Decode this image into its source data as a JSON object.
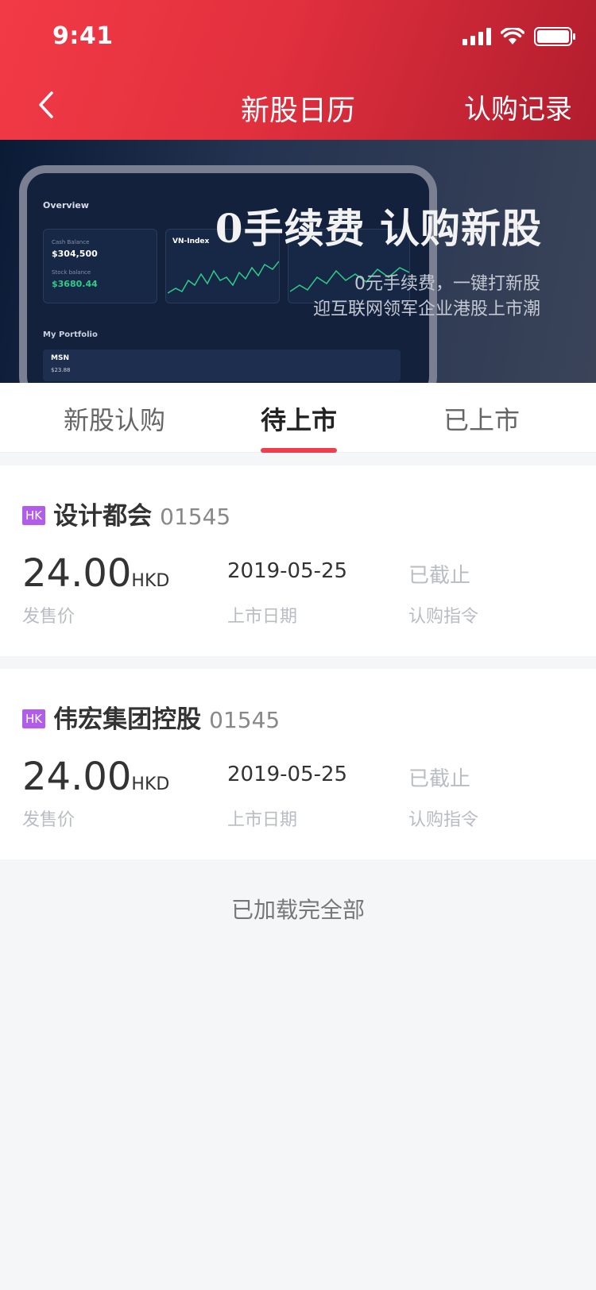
{
  "status_bar": {
    "time": "9:41"
  },
  "header": {
    "title": "新股日历",
    "right_link": "认购记录"
  },
  "banner": {
    "title": "0手续费 认购新股",
    "subtitle_line1": "0元手续费，一键打新股",
    "subtitle_line2": "迎互联网领军企业港股上市潮"
  },
  "tabs": [
    {
      "label": "新股认购",
      "active": false
    },
    {
      "label": "待上市",
      "active": true
    },
    {
      "label": "已上市",
      "active": false
    }
  ],
  "ipo_list": [
    {
      "market_badge": "HK",
      "name": "设计都会",
      "code": "01545",
      "price": "24.00",
      "currency": "HKD",
      "price_label": "发售价",
      "listing_date": "2019-05-25",
      "listing_date_label": "上市日期",
      "order_status": "已截止",
      "order_label": "认购指令"
    },
    {
      "market_badge": "HK",
      "name": "伟宏集团控股",
      "code": "01545",
      "price": "24.00",
      "currency": "HKD",
      "price_label": "发售价",
      "listing_date": "2019-05-25",
      "listing_date_label": "上市日期",
      "order_status": "已截止",
      "order_label": "认购指令"
    }
  ],
  "footer": {
    "text": "已加载完全部"
  },
  "colors": {
    "header_gradient_start": "#f23a46",
    "header_gradient_end": "#b11d2d",
    "tab_indicator": "#ef3f4f",
    "hk_badge": "#b15de9",
    "muted_text": "#b9bcc2"
  }
}
